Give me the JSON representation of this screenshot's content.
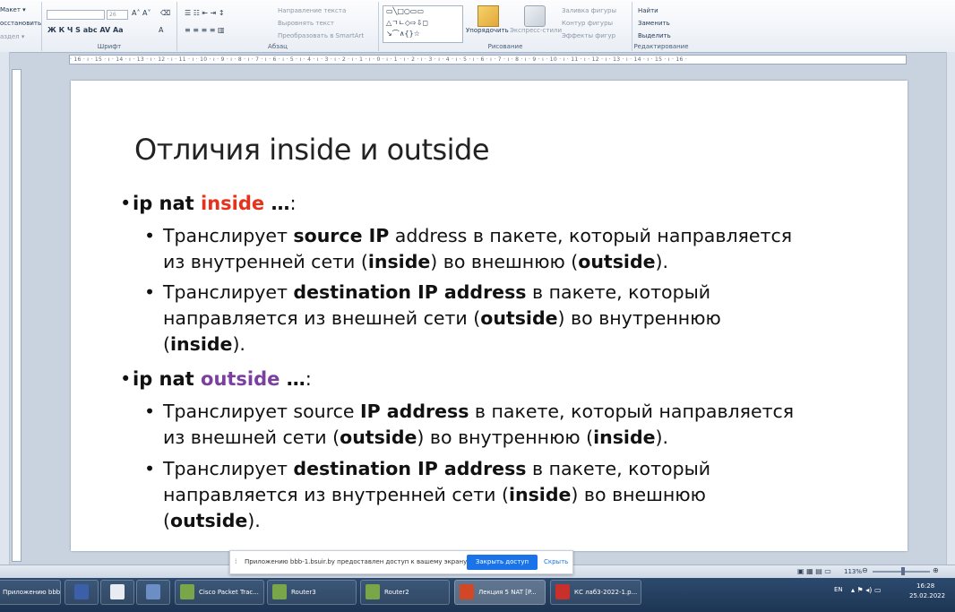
{
  "ribbon": {
    "clipboard_partial": {
      "layout": "Макет ▾",
      "reset": "осстановить",
      "section": "аздел ▾"
    },
    "font": {
      "font_size": "26",
      "label": "Шрифт"
    },
    "paragraph": {
      "label": "Абзац",
      "text_direction": "Направление текста",
      "align_text": "Выровнять текст",
      "smartart": "Преобразовать в SmartArt"
    },
    "drawing": {
      "label": "Рисование",
      "arrange": "Упорядочить",
      "quick_styles": "Экспресс-стили",
      "shape_fill": "Заливка фигуры",
      "shape_outline": "Контур фигуры",
      "shape_effects": "Эффекты фигур"
    },
    "editing": {
      "label": "Редактирование",
      "find": "Найти",
      "replace": "Заменить",
      "select": "Выделить"
    }
  },
  "ruler": "· 16 · ı · 15 · ı · 14 · ı · 13 · ı · 12 · ı · 11 · ı · 10 · ı · 9 · ı · 8 · ı · 7 · ı · 6 · ı · 5 · ı · 4 · ı · 3 · ı · 2 · ı · 1 · ı · 0 · ı · 1 · ı · 2 · ı · 3 · ı · 4 · ı · 5 · ı · 6 · ı · 7 · ı · 8 · ı · 9 · ı · 10 · ı · 11 · ı · 12 · ı · 13 · ı · 14 · ı · 15 · ı · 16 ·",
  "slide": {
    "title": "Отличия inside и outside",
    "b1": {
      "pre": "ip nat ",
      "hl": "inside",
      "post": " …",
      "colon": ":"
    },
    "b1a": {
      "t1": "Транслирует ",
      "t2": "source IP",
      "t3": " address в пакете, который направляется",
      "t4": "из внутренней сети (",
      "t5": "inside",
      "t6": ") во внешнюю (",
      "t7": "outside",
      "t8": ")."
    },
    "b1b": {
      "t1": "Транслирует ",
      "t2": "destination IP address",
      "t3": " в пакете, который",
      "t4": "направляется из внешней сети (",
      "t5": "outside",
      "t6": ") во внутреннюю",
      "t7": "(",
      "t8": "inside",
      "t9": ")."
    },
    "b2": {
      "pre": "ip nat ",
      "hl": "outside",
      "post": " …",
      "colon": ":"
    },
    "b2a": {
      "t1": "Транслирует source ",
      "t2": "IP address",
      "t3": " в пакете, который направляется",
      "t4": "из внешней сети (",
      "t5": "outside",
      "t6": ") во внутреннюю (",
      "t7": "inside",
      "t8": ")."
    },
    "b2b": {
      "t1": "Транслирует ",
      "t2": "destination IP address",
      "t3": " в пакете, который",
      "t4": "направляется из внутренней сети (",
      "t5": "inside",
      "t6": ") во внешнюю",
      "t7": "(",
      "t8": "outside",
      "t9": ")."
    }
  },
  "notification": {
    "message": "Приложению bbb-1.bsuir.by предоставлен доступ к вашему экрану.",
    "stop_button": "Закрыть доступ",
    "hide_link": "Скрыть"
  },
  "status": {
    "zoom": "113%"
  },
  "taskbar": {
    "items": [
      "Приложению bbb...",
      "",
      "",
      "",
      "Cisco Packet Trac...",
      "Router3",
      "Router2",
      "Лекция 5 NAT [P...",
      "КС лаб3-2022-1.p..."
    ],
    "lang": "EN",
    "time": "16:28",
    "date": "25.02.2022"
  },
  "colors": {
    "inside": "#e8311c",
    "outside": "#7a3fa0",
    "accent": "#1a73e8"
  }
}
